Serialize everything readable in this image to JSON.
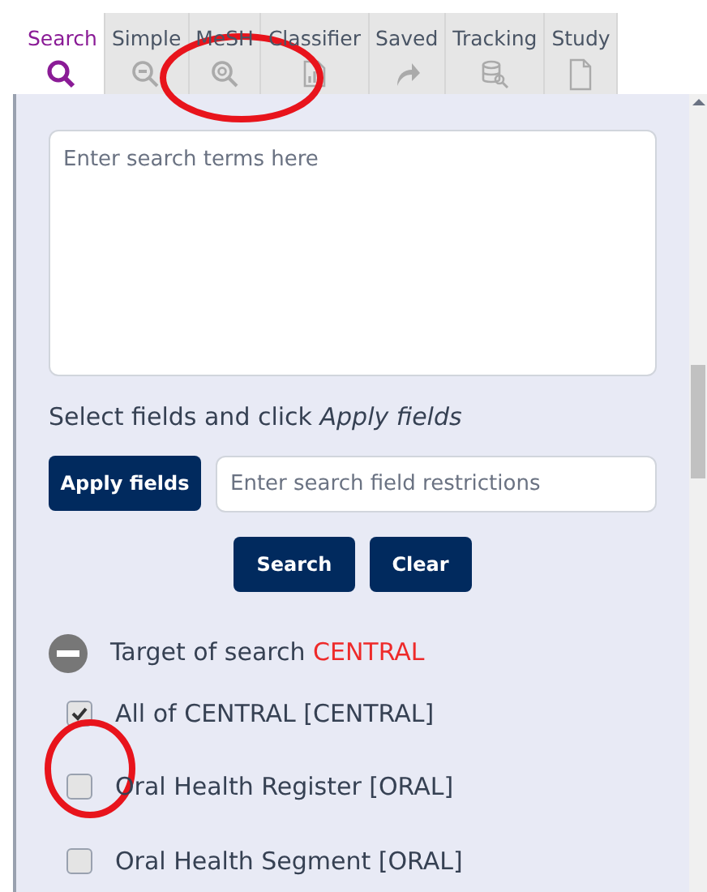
{
  "tabs": [
    {
      "label": "Search",
      "selected": true
    },
    {
      "label": "Simple",
      "selected": false
    },
    {
      "label": "MeSH",
      "selected": false
    },
    {
      "label": "Classifier",
      "selected": false
    },
    {
      "label": "Saved",
      "selected": false
    },
    {
      "label": "Tracking",
      "selected": false
    },
    {
      "label": "Study",
      "selected": false
    }
  ],
  "search_box": {
    "placeholder": "Enter search terms here"
  },
  "instruction": "Select fields and click *Apply fields*",
  "apply_button": "Apply fields",
  "field_restrictions": {
    "placeholder": "Enter search field restrictions"
  },
  "buttons": [
    "Search",
    "Clear"
  ],
  "target": {
    "label": "Target of search",
    "database": "CENTRAL",
    "expanded": true
  },
  "databases": [
    {
      "label": "All of CENTRAL [CENTRAL]",
      "checked": true
    },
    {
      "label": "Oral Health Register [ORAL]",
      "checked": false
    },
    {
      "label": "Oral Health Segment [ORAL]",
      "checked": false
    }
  ],
  "annotations": [
    {
      "kind": "ellipse",
      "color": "#e8141c"
    },
    {
      "kind": "ellipse",
      "color": "#e8141c"
    }
  ]
}
